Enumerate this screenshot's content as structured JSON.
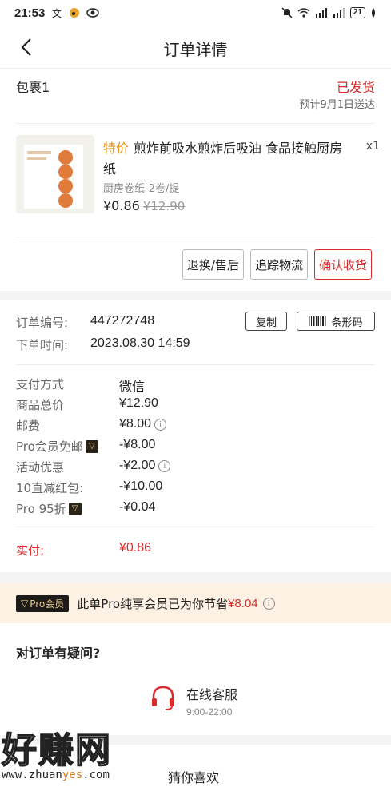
{
  "status_bar": {
    "time": "21:53",
    "battery": "21"
  },
  "nav": {
    "title": "订单详情"
  },
  "package": {
    "title": "包裹1",
    "status": "已发货",
    "eta": "预计9月1日送达",
    "product": {
      "tag": "特价",
      "name": "煎炸前吸水煎炸后吸油 食品接触厨房纸",
      "qty": "x1",
      "spec": "厨房卷纸-2卷/提",
      "price": "¥0.86",
      "original_price": "¥12.90"
    },
    "actions": {
      "return": "退换/售后",
      "track": "追踪物流",
      "confirm": "确认收货"
    }
  },
  "order": {
    "number_label": "订单编号:",
    "number": "447272748",
    "copy_label": "复制",
    "barcode_label": "条形码",
    "time_label": "下单时间:",
    "time": "2023.08.30 14:59",
    "payment": [
      {
        "label": "支付方式",
        "value": "微信"
      },
      {
        "label": "商品总价",
        "value": "¥12.90"
      },
      {
        "label": "邮费",
        "value": "¥8.00"
      },
      {
        "label": "Pro会员免邮",
        "value": "-¥8.00"
      },
      {
        "label": "活动优惠",
        "value": "-¥2.00"
      },
      {
        "label": "10直减红包:",
        "value": "-¥10.00"
      },
      {
        "label": "Pro 95折",
        "value": "-¥0.04"
      }
    ],
    "paid_label": "实付:",
    "paid_value": "¥0.86"
  },
  "pro_banner": {
    "tag": "Pro会员",
    "text": "此单Pro纯享会员已为你节省",
    "amount": "¥8.04"
  },
  "help": {
    "title": "对订单有疑问?",
    "service_name": "在线客服",
    "service_hours": "9:00-22:00"
  },
  "guess": {
    "title": "猜你喜欢"
  },
  "watermark": {
    "big": "好赚网",
    "url_a": "www.zhuan",
    "url_b": "yes",
    "url_c": ".com"
  },
  "colors": {
    "accent_red": "#d92b2b",
    "special_orange": "#e48b10",
    "pro_gold": "#e8c888"
  }
}
